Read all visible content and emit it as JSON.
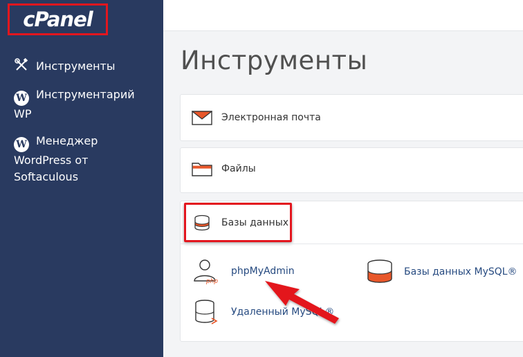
{
  "brand": {
    "logo": "cPanel"
  },
  "sidebar": {
    "items": [
      {
        "label_line1": "Инструменты",
        "label_line2": "",
        "label_line3": "",
        "icon": "tools-icon"
      },
      {
        "label_line1": "Инструментарий",
        "label_line2": "WP",
        "label_line3": "",
        "icon": "wordpress-icon"
      },
      {
        "label_line1": "Менеджер",
        "label_line2": "WordPress от",
        "label_line3": "Softaculous",
        "icon": "wordpress-icon"
      }
    ]
  },
  "main": {
    "title": "Инструменты",
    "sections": [
      {
        "label": "Электронная почта",
        "icon": "email-icon"
      },
      {
        "label": "Файлы",
        "icon": "folder-icon"
      },
      {
        "label": "Базы данных",
        "icon": "database-icon"
      }
    ],
    "database_tools": [
      {
        "label": "phpMyAdmin",
        "icon": "phpmyadmin-icon"
      },
      {
        "label": "Базы данных MySQL®",
        "icon": "mysql-database-icon"
      },
      {
        "label": "Удаленный MySQL®",
        "icon": "remote-mysql-icon"
      }
    ]
  },
  "colors": {
    "sidebar_bg": "#293a60",
    "highlight": "#e3161e",
    "accent_orange": "#e8572a",
    "link": "#264a80"
  }
}
